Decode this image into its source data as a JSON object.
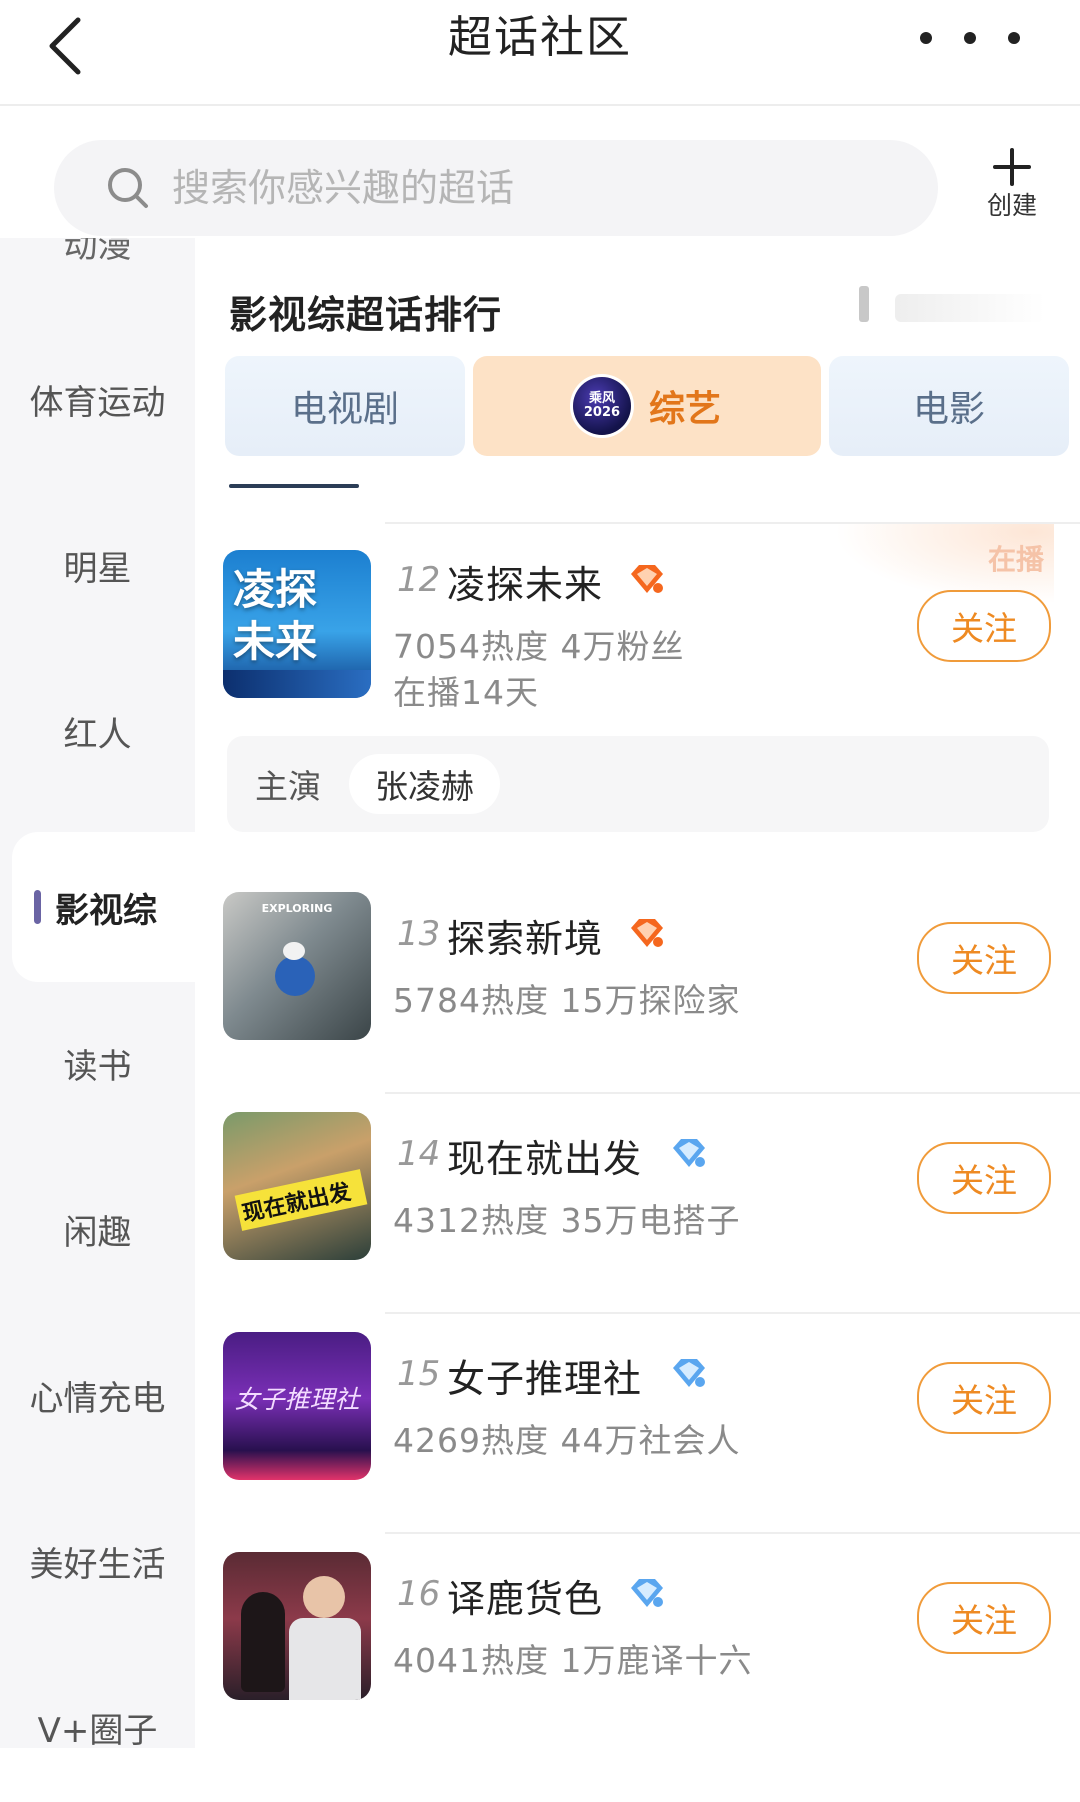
{
  "header": {
    "title": "超话社区",
    "back_icon": "chevron-left-icon",
    "more_icon": "more-dots-icon"
  },
  "search": {
    "placeholder": "搜索你感兴趣的超话",
    "create_label": "创建"
  },
  "sidebar": {
    "items": [
      {
        "label": "动漫",
        "partial": true
      },
      {
        "label": "体育运动"
      },
      {
        "label": "明星"
      },
      {
        "label": "红人"
      },
      {
        "label": "影视综",
        "active": true
      },
      {
        "label": "读书"
      },
      {
        "label": "闲趣"
      },
      {
        "label": "心情充电"
      },
      {
        "label": "美好生活"
      },
      {
        "label": "V+圈子"
      }
    ]
  },
  "main": {
    "section_title": "影视综超话排行",
    "tabs": [
      {
        "label": "电视剧"
      },
      {
        "label": "综艺",
        "active": true,
        "badge_text": "乘风2026"
      },
      {
        "label": "电影"
      }
    ],
    "accent_color": "#ee8a22",
    "ranking": [
      {
        "rank": "12",
        "name": "凌探未来",
        "gem": "orange",
        "meta": "7054热度 4万粉丝",
        "meta2": "在播14天",
        "airing_label": "在播",
        "follow_label": "关注",
        "cast_role": "主演",
        "cast_name": "张凌赫",
        "cover_text": "凌探\n未来"
      },
      {
        "rank": "13",
        "name": "探索新境",
        "gem": "orange",
        "meta": "5784热度 15万探险家",
        "follow_label": "关注",
        "cover_text": "EXPLORING"
      },
      {
        "rank": "14",
        "name": "现在就出发",
        "gem": "blue",
        "meta": "4312热度 35万电搭子",
        "follow_label": "关注",
        "cover_text": "现在就出发"
      },
      {
        "rank": "15",
        "name": "女子推理社",
        "gem": "blue",
        "meta": "4269热度 44万社会人",
        "follow_label": "关注",
        "cover_text": "女子推理社"
      },
      {
        "rank": "16",
        "name": "译鹿货色",
        "gem": "blue",
        "meta": "4041热度 1万鹿译十六",
        "follow_label": "关注",
        "cover_text": ""
      }
    ]
  }
}
